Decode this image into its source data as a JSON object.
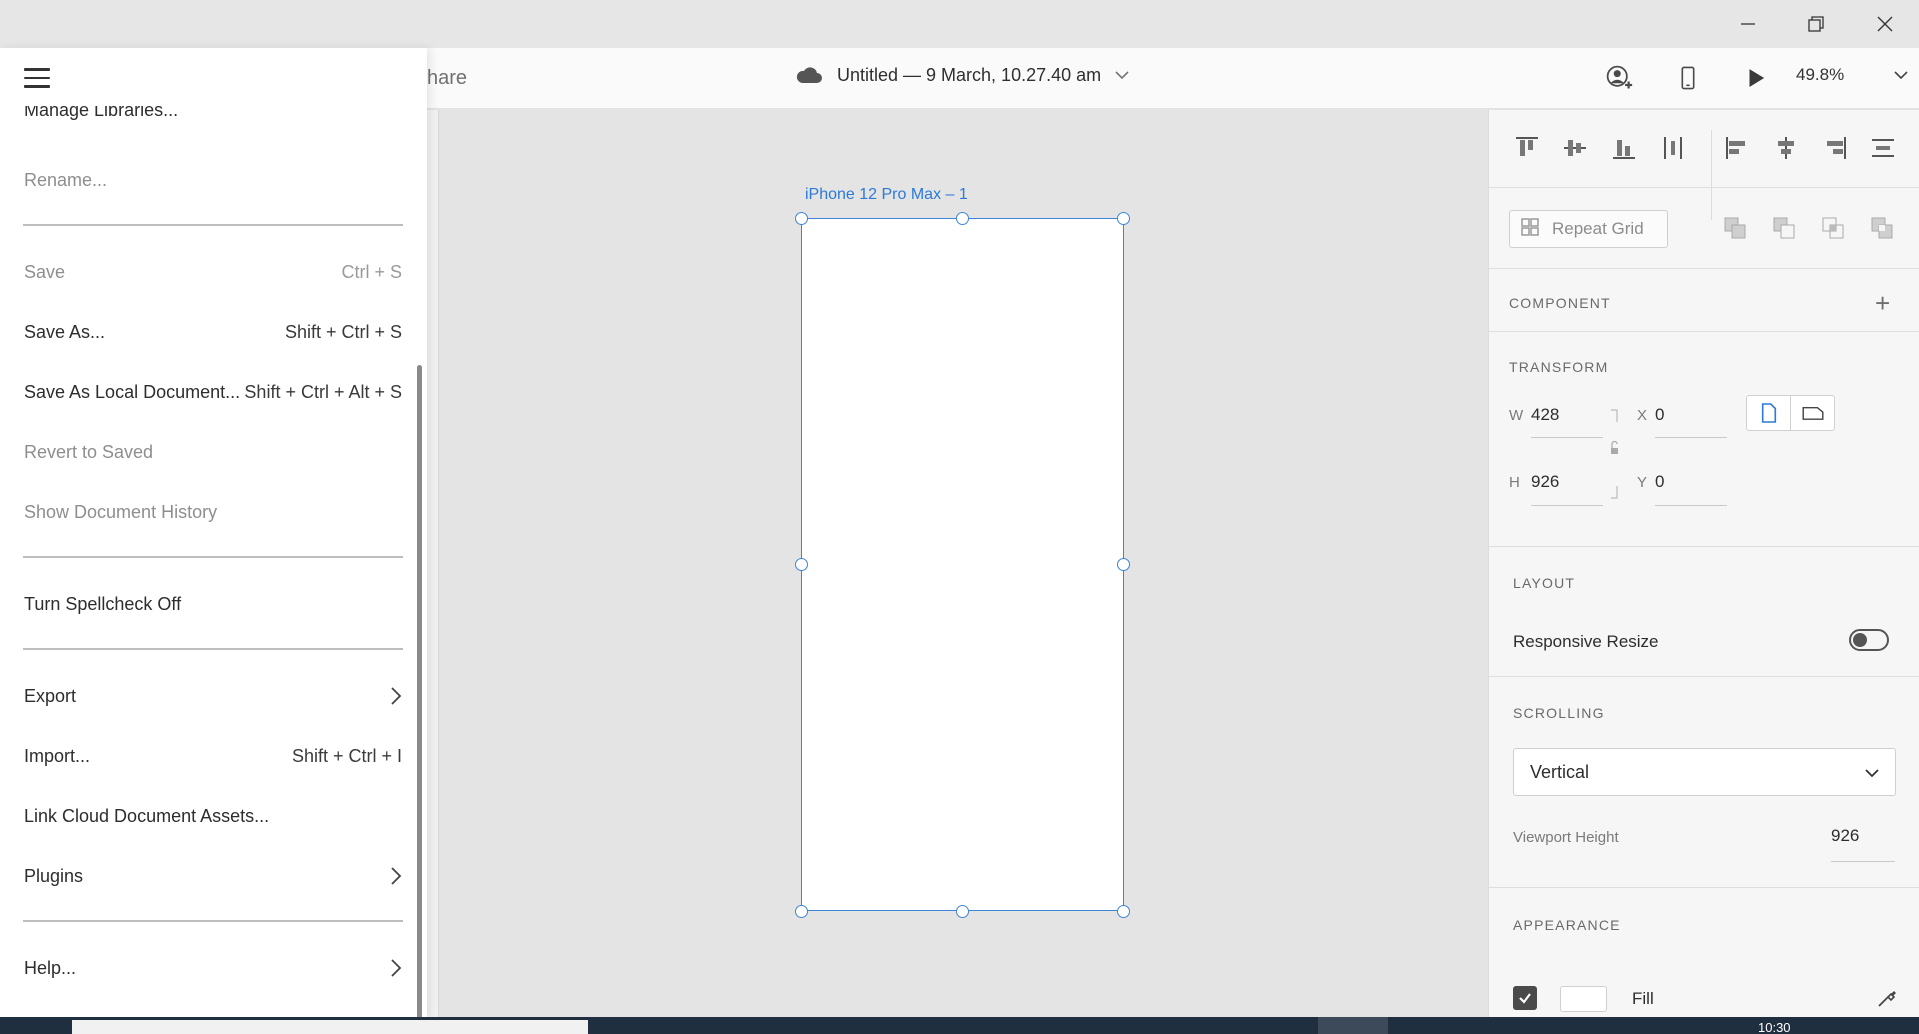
{
  "window": {
    "minimize_icon": "minimize-icon",
    "restore_icon": "restore-icon",
    "close_icon": "close-icon"
  },
  "header": {
    "share_text": "hare",
    "doc_title": "Untitled — 9 March, 10.27.40 am",
    "zoom": "49.8%"
  },
  "menu": {
    "cut_item": "Manage Libraries...",
    "rename": "Rename...",
    "save": {
      "label": "Save",
      "shortcut": "Ctrl + S"
    },
    "save_as": {
      "label": "Save As...",
      "shortcut": "Shift + Ctrl + S"
    },
    "save_local": {
      "label": "Save As Local Document...",
      "shortcut": "Shift + Ctrl + Alt + S"
    },
    "revert": "Revert to Saved",
    "history": "Show Document History",
    "spellcheck": "Turn Spellcheck Off",
    "export": "Export",
    "import": {
      "label": "Import...",
      "shortcut": "Shift + Ctrl + I"
    },
    "link_assets": "Link Cloud Document Assets...",
    "plugins": "Plugins",
    "help": "Help..."
  },
  "canvas": {
    "artboard_label": "iPhone 12 Pro Max – 1"
  },
  "props": {
    "repeat_grid": "Repeat Grid",
    "component_title": "COMPONENT",
    "transform_title": "TRANSFORM",
    "w_label": "W",
    "w_value": "428",
    "h_label": "H",
    "h_value": "926",
    "x_label": "X",
    "x_value": "0",
    "y_label": "Y",
    "y_value": "0",
    "layout_title": "LAYOUT",
    "responsive_resize": "Responsive Resize",
    "scrolling_title": "SCROLLING",
    "scrolling_value": "Vertical",
    "viewport_label": "Viewport Height",
    "viewport_value": "926",
    "appearance_title": "APPEARANCE",
    "fill_label": "Fill"
  },
  "taskbar": {
    "clock": "10:30"
  },
  "colors": {
    "accent": "#3d85d8",
    "panel": "#f6f6f6",
    "menu": "#ffffff"
  }
}
